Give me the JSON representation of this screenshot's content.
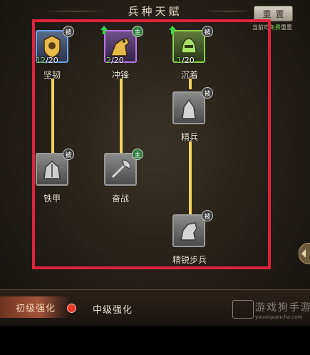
{
  "header": {
    "title": "兵种天赋",
    "reset_label": "重置",
    "reset_note_prefix": "当前可",
    "reset_note_highlight": "免费",
    "reset_note_suffix": "重置"
  },
  "talents": [
    {
      "id": "jianren",
      "name": "坚韧",
      "type_tag": "被",
      "level_current": "12",
      "level_max": "/20",
      "upgradable": false,
      "frame": "blue"
    },
    {
      "id": "chongfeng",
      "name": "冲锋",
      "type_tag": "主",
      "level_current": "2",
      "level_max": "/20",
      "upgradable": true,
      "frame": "purple"
    },
    {
      "id": "chenzhuo",
      "name": "沉着",
      "type_tag": "被",
      "level_current": "1",
      "level_max": "/20",
      "upgradable": true,
      "frame": "green"
    },
    {
      "id": "jingbing",
      "name": "精兵",
      "type_tag": "被",
      "locked": true
    },
    {
      "id": "tiejia",
      "name": "铁甲",
      "type_tag": "被",
      "locked": true
    },
    {
      "id": "fenzhan",
      "name": "奋战",
      "type_tag": "主",
      "locked": true
    },
    {
      "id": "jingruibubing",
      "name": "精锐步兵",
      "type_tag": "被",
      "locked": true
    }
  ],
  "tabs": {
    "primary": "初级强化",
    "secondary": "中级强化"
  },
  "watermark": {
    "title": "游戏狗手游",
    "url": "youxiquancha.com"
  },
  "colors": {
    "highlight_frame": "#e0233b",
    "connector": "#f3d35c",
    "level_current": "#7be04b"
  }
}
